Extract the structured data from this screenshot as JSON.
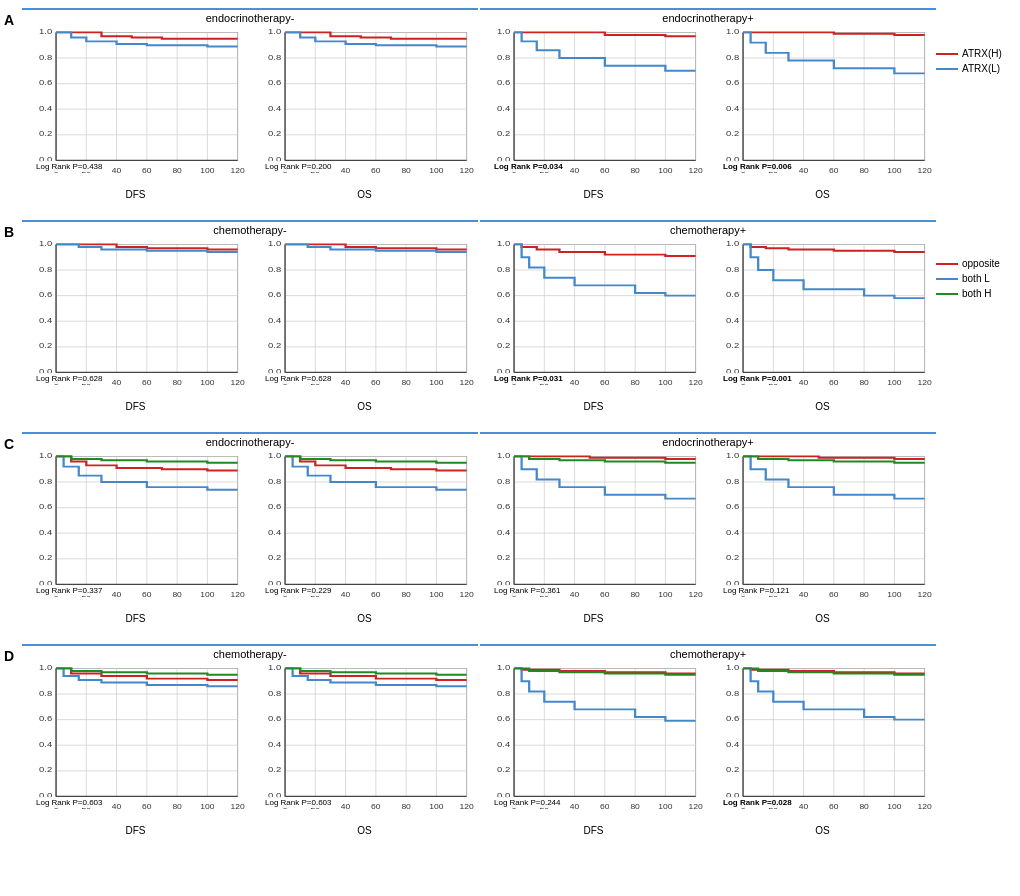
{
  "colors": {
    "red": "#cc2222",
    "blue": "#4488cc",
    "green": "#228822",
    "dark": "#222222",
    "axis": "#444",
    "grid": "#cccccc",
    "border_blue": "#4a90d9"
  },
  "legend_ab": [
    {
      "label": "ATRX(H)",
      "color": "#cc2222"
    },
    {
      "label": "ATRX(L)",
      "color": "#4488cc"
    }
  ],
  "legend_cd": [
    {
      "label": "opposite",
      "color": "#cc2222"
    },
    {
      "label": "both L",
      "color": "#4488cc"
    },
    {
      "label": "both H",
      "color": "#228822"
    }
  ],
  "rows": [
    {
      "id": "A",
      "groups": [
        {
          "title": "endocrinotherapy-",
          "charts": [
            {
              "pval": "Log Rank P=0.438",
              "bold": false,
              "xlabel": "DFS"
            },
            {
              "pval": "Log Rank P=0.200",
              "bold": false,
              "xlabel": "OS"
            }
          ]
        },
        {
          "title": "endocrinotherapy+",
          "charts": [
            {
              "pval": "Log Rank P=0.034",
              "bold": true,
              "xlabel": "DFS"
            },
            {
              "pval": "Log Rank P=0.006",
              "bold": true,
              "xlabel": "OS"
            }
          ]
        }
      ]
    },
    {
      "id": "B",
      "groups": [
        {
          "title": "chemotherapy-",
          "charts": [
            {
              "pval": "Log Rank P=0.628",
              "bold": false,
              "xlabel": "DFS"
            },
            {
              "pval": "Log Rank P=0.628",
              "bold": false,
              "xlabel": "OS"
            }
          ]
        },
        {
          "title": "chemotherapy+",
          "charts": [
            {
              "pval": "Log Rank P=0.031",
              "bold": true,
              "xlabel": "DFS"
            },
            {
              "pval": "Log Rank P=0.001",
              "bold": true,
              "xlabel": "OS"
            }
          ]
        }
      ]
    },
    {
      "id": "C",
      "groups": [
        {
          "title": "endocrinotherapy-",
          "charts": [
            {
              "pval": "Log Rank P=0.337",
              "bold": false,
              "xlabel": "DFS"
            },
            {
              "pval": "Log Rank P=0.229",
              "bold": false,
              "xlabel": "OS"
            }
          ]
        },
        {
          "title": "endocrinotherapy+",
          "charts": [
            {
              "pval": "Log Rank P=0.361",
              "bold": false,
              "xlabel": "DFS"
            },
            {
              "pval": "Log Rank P=0.121",
              "bold": false,
              "xlabel": "OS"
            }
          ]
        }
      ]
    },
    {
      "id": "D",
      "groups": [
        {
          "title": "chemotherapy-",
          "charts": [
            {
              "pval": "Log Rank P=0.603",
              "bold": false,
              "xlabel": "DFS"
            },
            {
              "pval": "Log Rank P=0.603",
              "bold": false,
              "xlabel": "OS"
            }
          ]
        },
        {
          "title": "chemotherapy+",
          "charts": [
            {
              "pval": "Log Rank P=0.244",
              "bold": false,
              "xlabel": "DFS"
            },
            {
              "pval": "Log Rank P=0.028",
              "bold": true,
              "xlabel": "OS"
            }
          ]
        }
      ]
    }
  ]
}
